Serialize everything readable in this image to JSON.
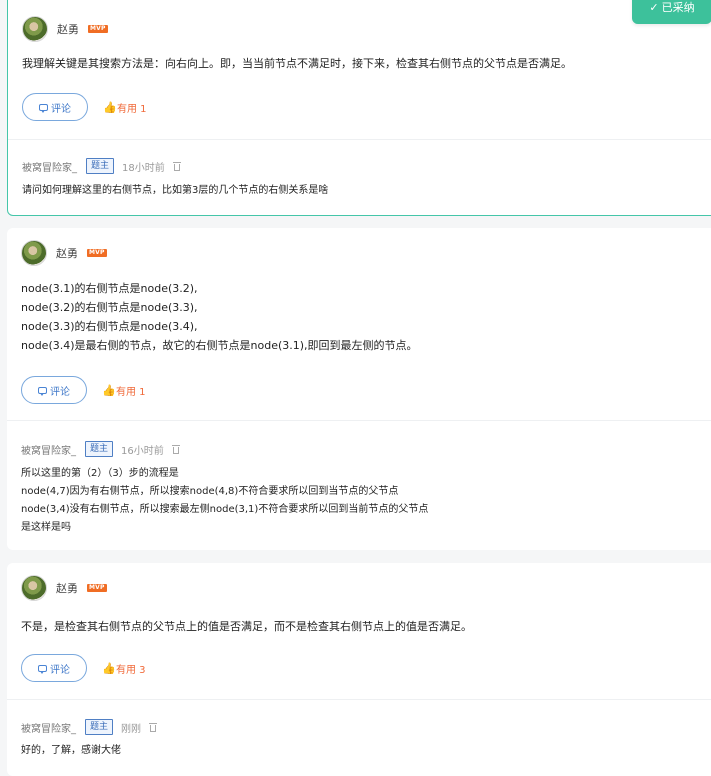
{
  "accepted_badge": {
    "icon": "check-icon",
    "label": "已采纳"
  },
  "answers": [
    {
      "author": "赵勇",
      "badge": "MVP",
      "body_lines": [
        "我理解关键是其搜索方法是：向右向上。即，当当前节点不满足时，接下来，检查其右侧节点的父节点是否满足。"
      ],
      "comment_label": "评论",
      "useful_label": "有用 1",
      "reply": {
        "author": "被窝冒险家_",
        "role": "题主",
        "time": "18小时前",
        "lines": [
          "请问如何理解这里的右侧节点，比如第3层的几个节点的右侧关系是啥"
        ]
      }
    },
    {
      "author": "赵勇",
      "badge": "MVP",
      "body_lines": [
        "node(3.1)的右侧节点是node(3.2),",
        "node(3.2)的右侧节点是node(3.3),",
        "node(3.3)的右侧节点是node(3.4),",
        "node(3.4)是最右侧的节点，故它的右侧节点是node(3.1),即回到最左侧的节点。"
      ],
      "comment_label": "评论",
      "useful_label": "有用 1",
      "reply": {
        "author": "被窝冒险家_",
        "role": "题主",
        "time": "16小时前",
        "lines": [
          "所以这里的第（2）（3）步的流程是",
          "node(4,7)因为有右侧节点，所以搜索node(4,8)不符合要求所以回到当节点的父节点",
          "node(3,4)没有右侧节点，所以搜索最左侧node(3,1)不符合要求所以回到当前节点的父节点",
          "是这样是吗"
        ]
      }
    },
    {
      "author": "赵勇",
      "badge": "MVP",
      "body_lines": [
        "不是，是检查其右侧节点的父节点上的值是否满足，而不是检查其右侧节点上的值是否满足。"
      ],
      "comment_label": "评论",
      "useful_label": "有用 3",
      "reply": {
        "author": "被窝冒险家_",
        "role": "题主",
        "time": "刚刚",
        "lines": [
          "好的，了解，感谢大佬"
        ]
      }
    }
  ],
  "colors": {
    "accent_green": "#3dc19b",
    "link_blue": "#3f78c9",
    "useful_orange": "#f06a3a",
    "mvp_orange": "#f06d24"
  },
  "icons": {
    "comment": "comment-icon",
    "useful": "thumbs-up-icon",
    "delete": "trash-icon",
    "avatar": "avatar"
  }
}
